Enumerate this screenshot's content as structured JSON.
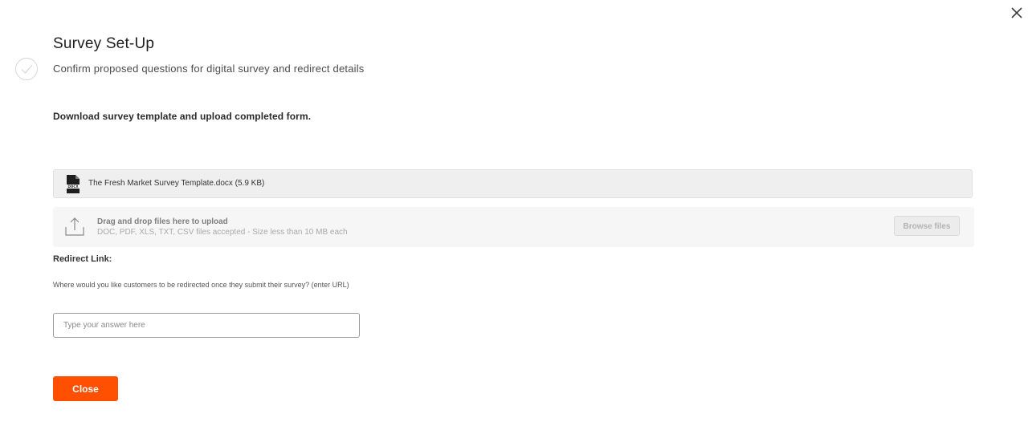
{
  "modal": {
    "close_icon": "close-icon",
    "step_icon": "check-circle-icon",
    "title": "Survey Set-Up",
    "subtitle": "Confirm proposed questions for digital survey and redirect details"
  },
  "template": {
    "instruction": "Download survey template and upload completed form.",
    "file_icon": "docx-file-icon",
    "file_label": "DOCX",
    "file_name": "The Fresh Market Survey Template.docx (5.9 KB)"
  },
  "upload": {
    "icon": "upload-icon",
    "title": "Drag and drop files here to upload",
    "subtitle": "DOC, PDF, XLS, TXT, CSV files accepted - Size less than 10 MB each",
    "browse_label": "Browse files"
  },
  "redirect": {
    "label": "Redirect Link:",
    "question": "Where would you like customers to be redirected once they submit their survey? (enter URL)",
    "input_value": "",
    "input_placeholder": "Type your answer here"
  },
  "footer": {
    "close_label": "Close"
  },
  "colors": {
    "accent": "#fe5000",
    "upload_bg": "#f6f6f6",
    "template_bg": "#efefef"
  }
}
